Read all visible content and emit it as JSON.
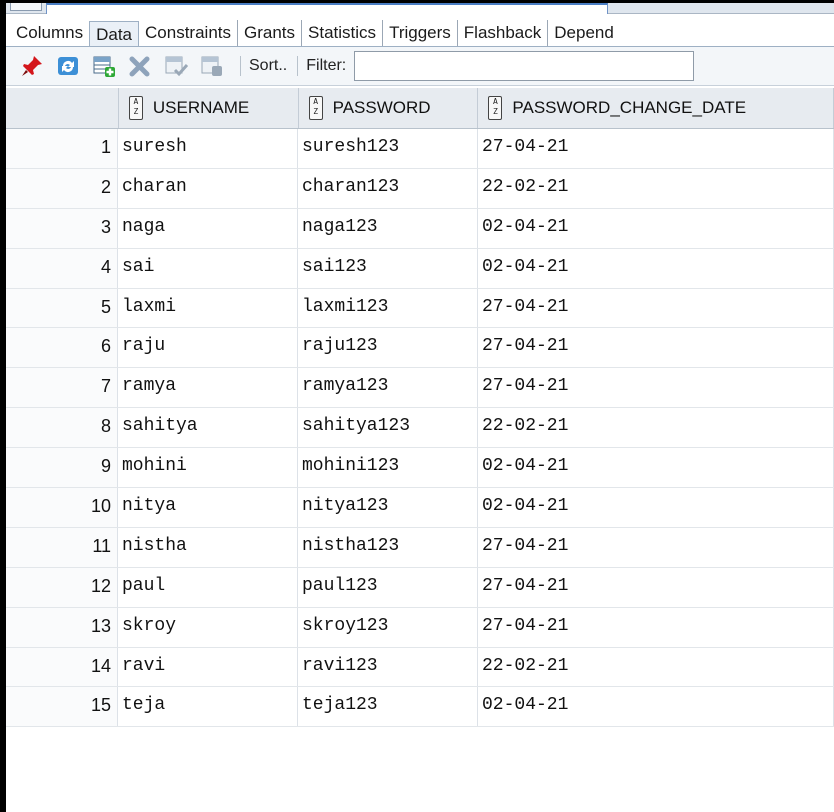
{
  "subtabs": [
    "Columns",
    "Data",
    "Constraints",
    "Grants",
    "Statistics",
    "Triggers",
    "Flashback",
    "Depend"
  ],
  "active_tab": "Data",
  "toolbar": {
    "sort_label": "Sort..",
    "filter_label": "Filter:",
    "filter_value": ""
  },
  "columns": [
    "USERNAME",
    "PASSWORD",
    "PASSWORD_CHANGE_DATE"
  ],
  "rows": [
    {
      "n": "1",
      "user": "suresh",
      "pass": "suresh123",
      "date": "27-04-21"
    },
    {
      "n": "2",
      "user": "charan",
      "pass": "charan123",
      "date": "22-02-21"
    },
    {
      "n": "3",
      "user": "naga",
      "pass": "naga123",
      "date": "02-04-21"
    },
    {
      "n": "4",
      "user": "sai",
      "pass": "sai123",
      "date": "02-04-21"
    },
    {
      "n": "5",
      "user": "laxmi",
      "pass": "laxmi123",
      "date": "27-04-21"
    },
    {
      "n": "6",
      "user": "raju",
      "pass": "raju123",
      "date": "27-04-21"
    },
    {
      "n": "7",
      "user": "ramya",
      "pass": "ramya123",
      "date": "27-04-21"
    },
    {
      "n": "8",
      "user": "sahitya",
      "pass": "sahitya123",
      "date": "22-02-21"
    },
    {
      "n": "9",
      "user": "mohini",
      "pass": "mohini123",
      "date": "02-04-21"
    },
    {
      "n": "10",
      "user": "nitya",
      "pass": "nitya123",
      "date": "02-04-21"
    },
    {
      "n": "11",
      "user": "nistha",
      "pass": "nistha123",
      "date": "27-04-21"
    },
    {
      "n": "12",
      "user": "paul",
      "pass": "paul123",
      "date": "27-04-21"
    },
    {
      "n": "13",
      "user": "skroy",
      "pass": "skroy123",
      "date": "27-04-21"
    },
    {
      "n": "14",
      "user": "ravi",
      "pass": "ravi123",
      "date": "22-02-21"
    },
    {
      "n": "15",
      "user": "teja",
      "pass": "teja123",
      "date": "02-04-21"
    }
  ]
}
